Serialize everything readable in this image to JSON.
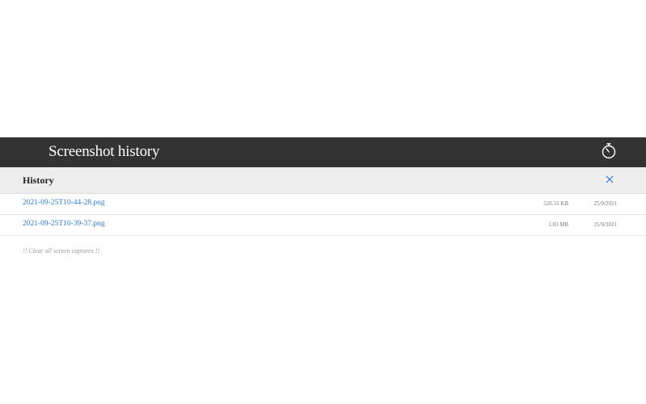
{
  "header": {
    "title": "Screenshot history",
    "timer_icon": "stopwatch-icon"
  },
  "history": {
    "label": "History",
    "close_icon": "close-icon",
    "close_color": "#2a7bd4",
    "items": [
      {
        "name": "2021-09-25T10-44-28.png",
        "size": "520.33 KB",
        "date": "25/9/2021"
      },
      {
        "name": "2021-09-25T10-39-37.png",
        "size": "2.83 MB",
        "date": "25/9/2021"
      }
    ],
    "clear_label": "!! Clear all screen captures !!"
  }
}
